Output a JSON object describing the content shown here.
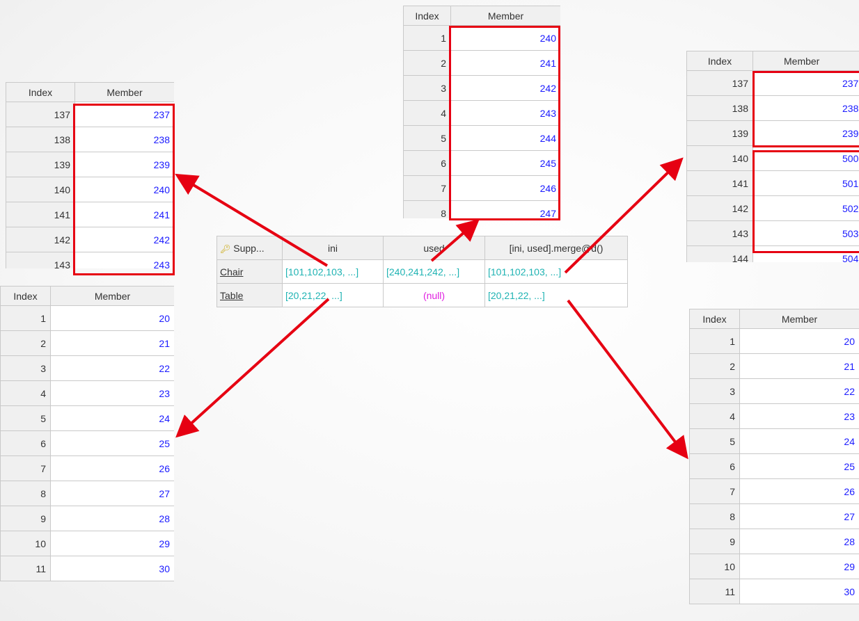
{
  "grid_headers": {
    "index": "Index",
    "member": "Member"
  },
  "main_table": {
    "headers": [
      "Supp...",
      "ini",
      "used",
      "[ini, used].merge@d()"
    ],
    "rows": [
      {
        "key": "Chair",
        "ini": "[101,102,103, ...]",
        "used": "[240,241,242, ...]",
        "merge": "[101,102,103, ...]"
      },
      {
        "key": "Table",
        "ini": "[20,21,22, ...]",
        "used": "(null)",
        "merge": "[20,21,22, ...]"
      }
    ]
  },
  "panel_left_top": {
    "rows": [
      {
        "i": "137",
        "m": "237"
      },
      {
        "i": "138",
        "m": "238"
      },
      {
        "i": "139",
        "m": "239"
      },
      {
        "i": "140",
        "m": "240"
      },
      {
        "i": "141",
        "m": "241"
      },
      {
        "i": "142",
        "m": "242"
      },
      {
        "i": "143",
        "m": "243"
      }
    ]
  },
  "panel_top_center": {
    "rows": [
      {
        "i": "1",
        "m": "240"
      },
      {
        "i": "2",
        "m": "241"
      },
      {
        "i": "3",
        "m": "242"
      },
      {
        "i": "4",
        "m": "243"
      },
      {
        "i": "5",
        "m": "244"
      },
      {
        "i": "6",
        "m": "245"
      },
      {
        "i": "7",
        "m": "246"
      },
      {
        "i": "8",
        "m": "247"
      }
    ]
  },
  "panel_right_top": {
    "rows": [
      {
        "i": "137",
        "m": "237"
      },
      {
        "i": "138",
        "m": "238"
      },
      {
        "i": "139",
        "m": "239"
      },
      {
        "i": "140",
        "m": "500"
      },
      {
        "i": "141",
        "m": "501"
      },
      {
        "i": "142",
        "m": "502"
      },
      {
        "i": "143",
        "m": "503"
      },
      {
        "i": "144",
        "m": "504"
      }
    ]
  },
  "panel_left_bottom": {
    "rows": [
      {
        "i": "1",
        "m": "20"
      },
      {
        "i": "2",
        "m": "21"
      },
      {
        "i": "3",
        "m": "22"
      },
      {
        "i": "4",
        "m": "23"
      },
      {
        "i": "5",
        "m": "24"
      },
      {
        "i": "6",
        "m": "25"
      },
      {
        "i": "7",
        "m": "26"
      },
      {
        "i": "8",
        "m": "27"
      },
      {
        "i": "9",
        "m": "28"
      },
      {
        "i": "10",
        "m": "29"
      },
      {
        "i": "11",
        "m": "30"
      }
    ]
  },
  "panel_right_bottom": {
    "rows": [
      {
        "i": "1",
        "m": "20"
      },
      {
        "i": "2",
        "m": "21"
      },
      {
        "i": "3",
        "m": "22"
      },
      {
        "i": "4",
        "m": "23"
      },
      {
        "i": "5",
        "m": "24"
      },
      {
        "i": "6",
        "m": "25"
      },
      {
        "i": "7",
        "m": "26"
      },
      {
        "i": "8",
        "m": "27"
      },
      {
        "i": "9",
        "m": "28"
      },
      {
        "i": "10",
        "m": "29"
      },
      {
        "i": "11",
        "m": "30"
      }
    ]
  },
  "colors": {
    "highlight": "#e60012",
    "member_text": "#1a1aff",
    "sequence_text": "#1fb3b3",
    "null_text": "#e020e0"
  }
}
